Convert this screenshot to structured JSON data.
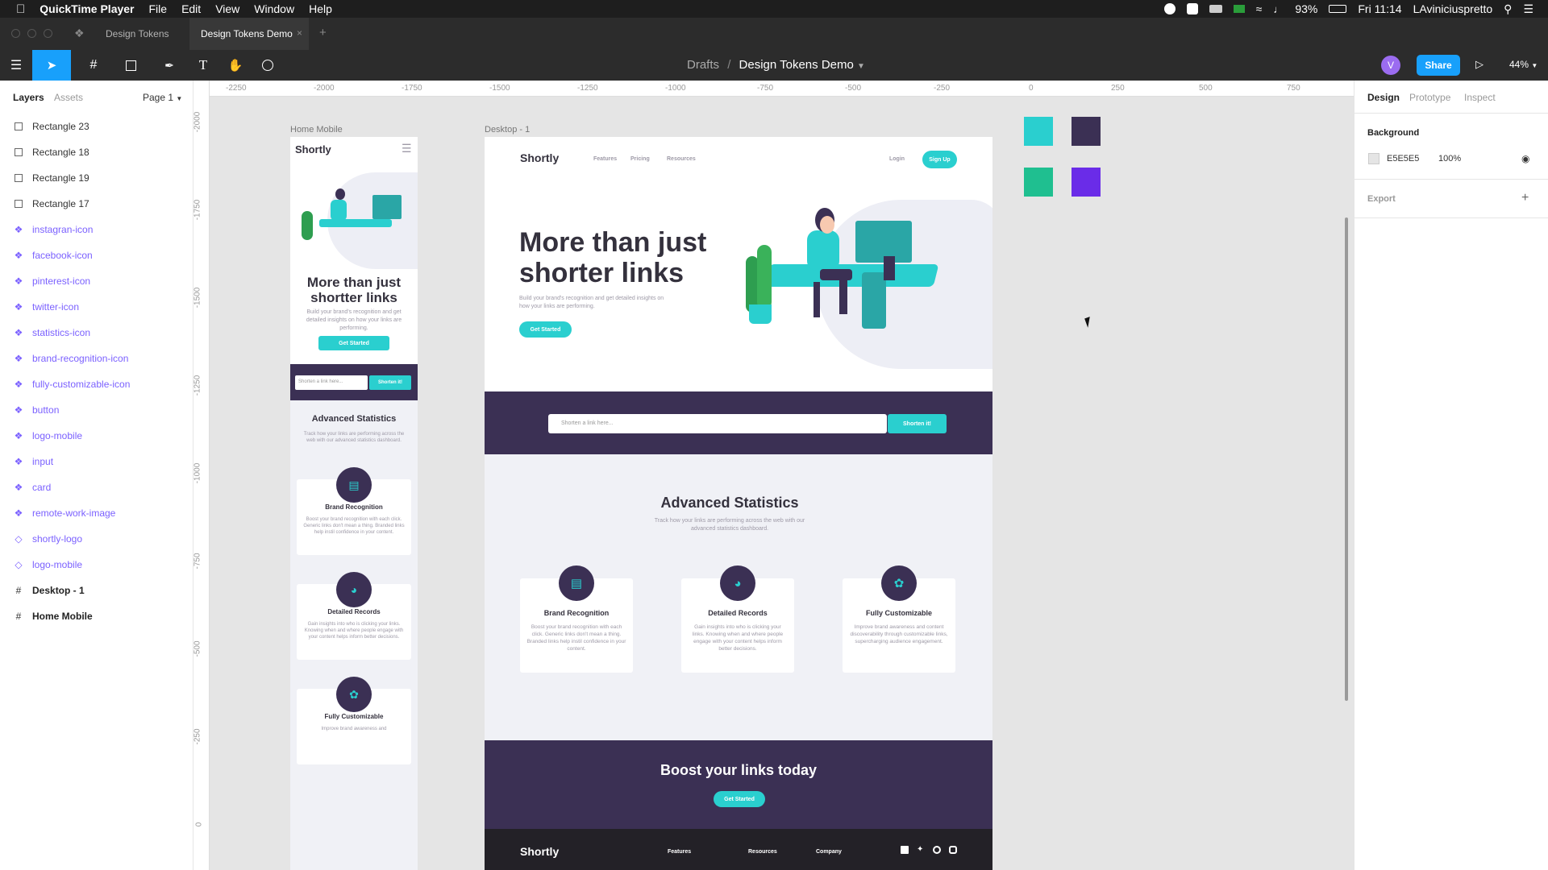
{
  "menubar": {
    "app": "QuickTime Player",
    "menus": [
      "File",
      "Edit",
      "View",
      "Window",
      "Help"
    ],
    "battery": "93%",
    "clock": "Fri 11:14",
    "user": "LAviniciuspretto"
  },
  "tabs": {
    "tab1": "Design Tokens",
    "tab2": "Design Tokens Demo"
  },
  "toolbar": {
    "breadcrumb_parent": "Drafts",
    "breadcrumb_sep": "/",
    "file_name": "Design Tokens Demo",
    "avatar_initial": "V",
    "share_label": "Share",
    "zoom": "44%"
  },
  "left_panel": {
    "tab_layers": "Layers",
    "tab_assets": "Assets",
    "page": "Page 1",
    "layers": [
      {
        "label": "Rectangle 23",
        "kind": "rect"
      },
      {
        "label": "Rectangle 18",
        "kind": "rect"
      },
      {
        "label": "Rectangle 19",
        "kind": "rect"
      },
      {
        "label": "Rectangle 17",
        "kind": "rect"
      },
      {
        "label": "instagran-icon",
        "kind": "component"
      },
      {
        "label": "facebook-icon",
        "kind": "component"
      },
      {
        "label": "pinterest-icon",
        "kind": "component"
      },
      {
        "label": "twitter-icon",
        "kind": "component"
      },
      {
        "label": "statistics-icon",
        "kind": "component"
      },
      {
        "label": "brand-recognition-icon",
        "kind": "component"
      },
      {
        "label": "fully-customizable-icon",
        "kind": "component"
      },
      {
        "label": "button",
        "kind": "component"
      },
      {
        "label": "logo-mobile",
        "kind": "component"
      },
      {
        "label": "input",
        "kind": "component"
      },
      {
        "label": "card",
        "kind": "component"
      },
      {
        "label": "remote-work-image",
        "kind": "component"
      },
      {
        "label": "shortly-logo",
        "kind": "instance"
      },
      {
        "label": "logo-mobile",
        "kind": "instance"
      },
      {
        "label": "Desktop - 1",
        "kind": "frame"
      },
      {
        "label": "Home Mobile",
        "kind": "frame"
      }
    ]
  },
  "right_panel": {
    "tab_design": "Design",
    "tab_prototype": "Prototype",
    "tab_inspect": "Inspect",
    "background_heading": "Background",
    "bg_hex": "E5E5E5",
    "bg_opacity": "100%",
    "export_heading": "Export",
    "colors": {
      "bg_swatch": "#e5e5e5",
      "accent": "#18a0fb"
    }
  },
  "canvas": {
    "rulers_top": [
      "-2250",
      "-2000",
      "-1750",
      "-1500",
      "-1250",
      "-1000",
      "-750",
      "-500",
      "-250",
      "0",
      "250",
      "500",
      "750"
    ],
    "rulers_left": [
      "-2000",
      "-1750",
      "-1500",
      "-1250",
      "-1000",
      "-750",
      "-500",
      "-250",
      "0"
    ],
    "frame_mobile_label": "Home Mobile",
    "frame_desktop_label": "Desktop - 1",
    "swatches": [
      "#2acfcf",
      "#3b3054",
      "#1fbf90",
      "#6a2ce8"
    ]
  },
  "mobile": {
    "logo": "Shortly",
    "headline": "More than just shortter links",
    "sub": "Build your brand's recognition and get detailed insights on how your links are performing.",
    "cta": "Get Started",
    "input_placeholder": "Shorten a link here...",
    "shorten": "Shorten it!",
    "stats_title": "Advanced Statistics",
    "stats_sub": "Track how your links are performing across the web with our advanced statistics dashboard.",
    "card1_title": "Brand Recognition",
    "card1_text": "Boost your brand recognition with each click. Generic links don't mean a thing. Branded links help instil confidence in your content.",
    "card2_title": "Detailed Records",
    "card2_text": "Gain insights into who is clicking your links. Knowing when and where people engage with your content helps inform better decisions.",
    "card3_title": "Fully Customizable",
    "card3_text": "Improve brand awareness and"
  },
  "desktop": {
    "logo": "Shortly",
    "nav": [
      "Features",
      "Pricing",
      "Resources"
    ],
    "login": "Login",
    "signup": "Sign Up",
    "headline_1": "More than just",
    "headline_2": "shorter links",
    "sub": "Build your brand's recognition and get detailed insights on how your links are performing.",
    "cta": "Get Started",
    "input_placeholder": "Shorten a link here...",
    "shorten": "Shorten it!",
    "stats_title": "Advanced Statistics",
    "stats_sub": "Track how your links are performing across the web with our advanced statistics dashboard.",
    "cards": [
      {
        "title": "Brand Recognition",
        "text": "Boost your brand recognition with each click. Generic links don't mean a thing. Branded links help instil confidence in your content."
      },
      {
        "title": "Detailed Records",
        "text": "Gain insights into who is clicking your links. Knowing when and where people engage with your content helps inform better decisions."
      },
      {
        "title": "Fully Customizable",
        "text": "Improve brand awareness and content discoverability through customizable links, supercharging audience engagement."
      }
    ],
    "boost_title": "Boost your links today",
    "boost_cta": "Get Started",
    "footer_logo": "Shortly",
    "footer_cols": [
      "Features",
      "Resources",
      "Company"
    ]
  }
}
